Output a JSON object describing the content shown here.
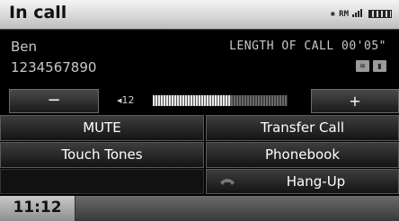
{
  "header": {
    "title": "In call",
    "bluetooth_icon": "bluetooth-icon",
    "roaming": "RM",
    "signal_icon": "signal-icon",
    "battery_icon": "battery-icon"
  },
  "call": {
    "caller_name": "Ben",
    "caller_number": "1234567890",
    "length_label": "LENGTH OF CALL 00'05\"",
    "icons": [
      "hfl-icon",
      "phone-handset-icon"
    ]
  },
  "volume": {
    "minus_label": "−",
    "plus_label": "+",
    "level_label": "◂12",
    "level_fraction": 0.58
  },
  "menu": {
    "mute": "MUTE",
    "transfer": "Transfer Call",
    "touch_tones": "Touch Tones",
    "phonebook": "Phonebook",
    "hang_up": "Hang-Up",
    "hang_up_icon": "hang-up-phone-icon"
  },
  "footer": {
    "clock": "11:12"
  },
  "colors": {
    "header_bg": "#d8d8d8",
    "text_gray": "#c8c8c8",
    "button_dark": "#1a1a1a"
  }
}
